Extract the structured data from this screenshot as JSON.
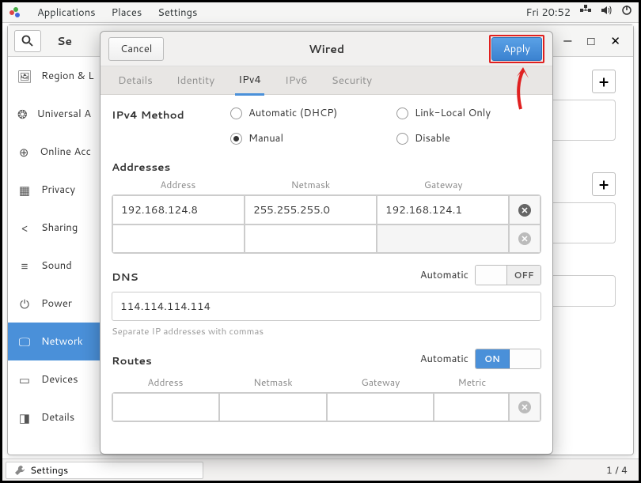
{
  "menubar": {
    "applications": "Applications",
    "places": "Places",
    "settings": "Settings",
    "clock": "Fri 20:52"
  },
  "settings_window": {
    "title": "Se",
    "sidebar": [
      {
        "icon": "🖼",
        "label": "Region & L"
      },
      {
        "icon": "❂",
        "label": "Universal A"
      },
      {
        "icon": "⊕",
        "label": "Online Acc"
      },
      {
        "icon": "▦",
        "label": "Privacy"
      },
      {
        "icon": "<",
        "label": "Sharing"
      },
      {
        "icon": "≡",
        "label": "Sound"
      },
      {
        "icon": "⏻",
        "label": "Power"
      },
      {
        "icon": "🖵",
        "label": "Network"
      },
      {
        "icon": "▭",
        "label": "Devices"
      },
      {
        "icon": "◨",
        "label": "Details"
      }
    ],
    "add": "+"
  },
  "dialog": {
    "cancel": "Cancel",
    "title": "Wired",
    "apply": "Apply",
    "tabs": [
      "Details",
      "Identity",
      "IPv4",
      "IPv6",
      "Security"
    ],
    "active_tab": "IPv4",
    "method": {
      "label": "IPv4 Method",
      "options": {
        "auto": "Automatic (DHCP)",
        "link": "Link-Local Only",
        "manual": "Manual",
        "disable": "Disable"
      },
      "selected": "Manual"
    },
    "addresses": {
      "title": "Addresses",
      "headers": {
        "addr": "Address",
        "mask": "Netmask",
        "gw": "Gateway"
      },
      "rows": [
        {
          "addr": "192.168.124.8",
          "mask": "255.255.255.0",
          "gw": "192.168.124.1"
        }
      ]
    },
    "dns": {
      "title": "DNS",
      "auto_label": "Automatic",
      "toggle": "OFF",
      "value": "114.114.114.114",
      "hint": "Separate IP addresses with commas"
    },
    "routes": {
      "title": "Routes",
      "auto_label": "Automatic",
      "toggle": "ON",
      "headers": {
        "addr": "Address",
        "mask": "Netmask",
        "gw": "Gateway",
        "metric": "Metric"
      }
    }
  },
  "taskbar": {
    "app": "Settings",
    "page": "1 / 4"
  }
}
